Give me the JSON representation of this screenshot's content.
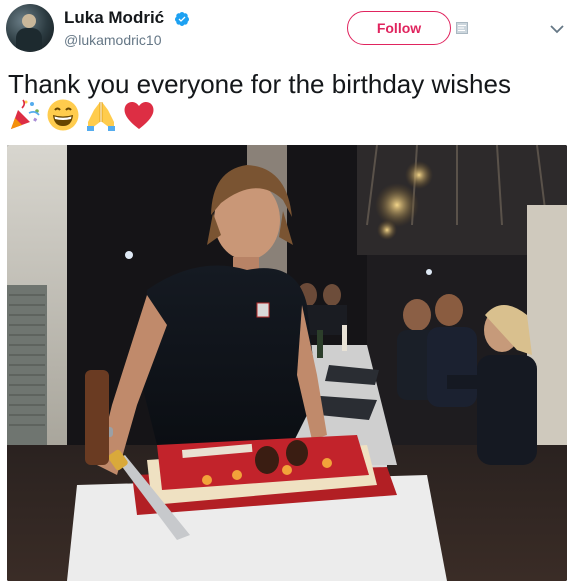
{
  "user": {
    "display_name": "Luka Modrić",
    "handle": "@lukamodric10",
    "verified": true
  },
  "actions": {
    "follow_label": "Follow"
  },
  "tweet": {
    "text": "Thank you everyone for the birthday wishes",
    "emojis": [
      "party-popper",
      "grinning-face",
      "folded-hands",
      "red-heart"
    ]
  },
  "media": {
    "description_icon": "photo"
  },
  "colors": {
    "follow_accent": "#e0245e",
    "verified_blue": "#1da1f2",
    "handle_gray": "#657786",
    "text": "#14171a"
  }
}
